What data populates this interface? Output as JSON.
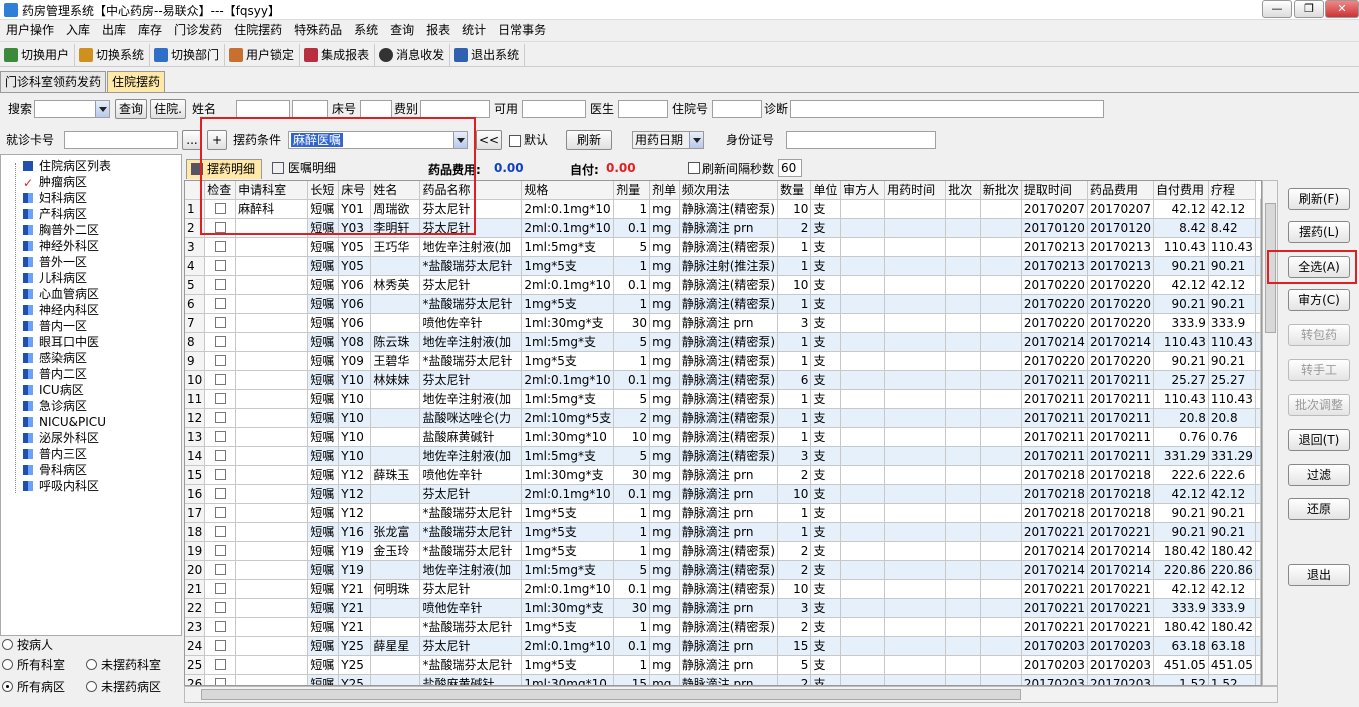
{
  "window": {
    "title": "药房管理系统【中心药房--易联众】---【fqsyy】",
    "controls": [
      "—",
      "❐",
      "✕"
    ]
  },
  "menu": [
    "用户操作",
    "入库",
    "出库",
    "库存",
    "门诊发药",
    "住院摆药",
    "特殊药品",
    "系统",
    "查询",
    "报表",
    "统计",
    "日常事务"
  ],
  "toolbar": [
    "切换用户",
    "切换系统",
    "切换部门",
    "用户锁定",
    "集成报表",
    "消息收发",
    "退出系统"
  ],
  "main_tabs": [
    "门诊科室领药发药",
    "住院摆药"
  ],
  "filters": {
    "search_label": "搜索",
    "query_btn": "查询",
    "ward_btn": "住院.",
    "name_label": "姓名",
    "bed_label": "床号",
    "fee_label": "费别",
    "avail_label": "可用",
    "doctor_label": "医生",
    "inpatient_label": "住院号",
    "diag_label": "诊断",
    "card_label": "就诊卡号",
    "ellipsis_btn": "...",
    "plus_btn": "+",
    "cond_label": "摆药条件",
    "cond_value": "麻醉医嘱",
    "back_btn": "<<",
    "default_label": "默认",
    "refresh_btn": "刷新",
    "date_value": "用药日期",
    "idcard_label": "身份证号"
  },
  "tree": {
    "root": "住院病区列表",
    "items": [
      "肿瘤病区",
      "妇科病区",
      "产科病区",
      "胸普外二区",
      "神经外科区",
      "普外一区",
      "儿科病区",
      "心血管病区",
      "神经内科区",
      "普内一区",
      "眼耳口中医",
      "感染病区",
      "普内二区",
      "ICU病区",
      "急诊病区",
      "NICU&PICU",
      "泌尿外科区",
      "普内三区",
      "骨科病区",
      "呼吸内科区"
    ]
  },
  "radios": {
    "by_patient": "按病人",
    "all_depts": "所有科室",
    "not_dispensed_depts": "未摆药科室",
    "all_wards": "所有病区",
    "not_dispensed_wards": "未摆药病区"
  },
  "subtabs": {
    "tab1": "摆药明细",
    "tab2": "医嘱明细",
    "drug_fee_label": "药品费用:",
    "drug_fee_value": "0.00",
    "self_pay_label": "自付:",
    "self_pay_value": "0.00",
    "refresh_interval_label": "刷新间隔秒数",
    "refresh_interval_value": "60"
  },
  "table": {
    "headers": [
      "",
      "检查",
      "申请科室",
      "长短",
      "床号",
      "姓名",
      "药品名称",
      "规格",
      "剂量",
      "剂单",
      "频次用法",
      "数量",
      "单位",
      "审方人",
      "用药时间",
      "批次",
      "新批次",
      "提取时间",
      "药品费用",
      "自付费用",
      "疗程"
    ],
    "rows": [
      [
        "1",
        "麻醉科",
        "短嘱",
        "Y01",
        "周瑞欲",
        "芬太尼针",
        "2ml:0.1mg*10",
        "1",
        "mg",
        "静脉滴注(精密泵)",
        "10",
        "支",
        "",
        "20170207",
        "20170207",
        "42.12",
        "42.12"
      ],
      [
        "2",
        "",
        "短嘱",
        "Y03",
        "李明轩",
        "芬太尼针",
        "2ml:0.1mg*10",
        "0.1",
        "mg",
        "静脉滴注 prn",
        "2",
        "支",
        "",
        "20170120",
        "20170120",
        "8.42",
        "8.42"
      ],
      [
        "3",
        "",
        "短嘱",
        "Y05",
        "王巧华",
        "地佐辛注射液(加",
        "1ml:5mg*支",
        "5",
        "mg",
        "静脉滴注(精密泵)",
        "1",
        "支",
        "",
        "20170213",
        "20170213",
        "110.43",
        "110.43"
      ],
      [
        "4",
        "",
        "短嘱",
        "Y05",
        "",
        "*盐酸瑞芬太尼针",
        "1mg*5支",
        "1",
        "mg",
        "静脉注射(推注泵)",
        "1",
        "支",
        "",
        "20170213",
        "20170213",
        "90.21",
        "90.21"
      ],
      [
        "5",
        "",
        "短嘱",
        "Y06",
        "林秀英",
        "芬太尼针",
        "2ml:0.1mg*10",
        "0.1",
        "mg",
        "静脉滴注(精密泵)",
        "10",
        "支",
        "",
        "20170220",
        "20170220",
        "42.12",
        "42.12"
      ],
      [
        "6",
        "",
        "短嘱",
        "Y06",
        "",
        "*盐酸瑞芬太尼针",
        "1mg*5支",
        "1",
        "mg",
        "静脉滴注(精密泵)",
        "1",
        "支",
        "",
        "20170220",
        "20170220",
        "90.21",
        "90.21"
      ],
      [
        "7",
        "",
        "短嘱",
        "Y06",
        "",
        "喷他佐辛针",
        "1ml:30mg*支",
        "30",
        "mg",
        "静脉滴注 prn",
        "3",
        "支",
        "",
        "20170220",
        "20170220",
        "333.9",
        "333.9"
      ],
      [
        "8",
        "",
        "短嘱",
        "Y08",
        "陈云珠",
        "地佐辛注射液(加",
        "1ml:5mg*支",
        "5",
        "mg",
        "静脉滴注(精密泵)",
        "1",
        "支",
        "",
        "20170214",
        "20170214",
        "110.43",
        "110.43"
      ],
      [
        "9",
        "",
        "短嘱",
        "Y09",
        "王碧华",
        "*盐酸瑞芬太尼针",
        "1mg*5支",
        "1",
        "mg",
        "静脉滴注(精密泵)",
        "1",
        "支",
        "",
        "20170220",
        "20170220",
        "90.21",
        "90.21"
      ],
      [
        "10",
        "",
        "短嘱",
        "Y10",
        "林妹妹",
        "芬太尼针",
        "2ml:0.1mg*10",
        "0.1",
        "mg",
        "静脉滴注(精密泵)",
        "6",
        "支",
        "",
        "20170211",
        "20170211",
        "25.27",
        "25.27"
      ],
      [
        "11",
        "",
        "短嘱",
        "Y10",
        "",
        "地佐辛注射液(加",
        "1ml:5mg*支",
        "5",
        "mg",
        "静脉滴注(精密泵)",
        "1",
        "支",
        "",
        "20170211",
        "20170211",
        "110.43",
        "110.43"
      ],
      [
        "12",
        "",
        "短嘱",
        "Y10",
        "",
        "盐酸咪达唑仑(力",
        "2ml:10mg*5支",
        "2",
        "mg",
        "静脉滴注(精密泵)",
        "1",
        "支",
        "",
        "20170211",
        "20170211",
        "20.8",
        "20.8"
      ],
      [
        "13",
        "",
        "短嘱",
        "Y10",
        "",
        "盐酸麻黄碱针",
        "1ml:30mg*10",
        "10",
        "mg",
        "静脉滴注(精密泵)",
        "1",
        "支",
        "",
        "20170211",
        "20170211",
        "0.76",
        "0.76"
      ],
      [
        "14",
        "",
        "短嘱",
        "Y10",
        "",
        "地佐辛注射液(加",
        "1ml:5mg*支",
        "5",
        "mg",
        "静脉滴注(精密泵)",
        "3",
        "支",
        "",
        "20170211",
        "20170211",
        "331.29",
        "331.29"
      ],
      [
        "15",
        "",
        "短嘱",
        "Y12",
        "薛珠玉",
        "喷他佐辛针",
        "1ml:30mg*支",
        "30",
        "mg",
        "静脉滴注 prn",
        "2",
        "支",
        "",
        "20170218",
        "20170218",
        "222.6",
        "222.6"
      ],
      [
        "16",
        "",
        "短嘱",
        "Y12",
        "",
        "芬太尼针",
        "2ml:0.1mg*10",
        "0.1",
        "mg",
        "静脉滴注 prn",
        "10",
        "支",
        "",
        "20170218",
        "20170218",
        "42.12",
        "42.12"
      ],
      [
        "17",
        "",
        "短嘱",
        "Y12",
        "",
        "*盐酸瑞芬太尼针",
        "1mg*5支",
        "1",
        "mg",
        "静脉滴注 prn",
        "1",
        "支",
        "",
        "20170218",
        "20170218",
        "90.21",
        "90.21"
      ],
      [
        "18",
        "",
        "短嘱",
        "Y16",
        "张龙富",
        "*盐酸瑞芬太尼针",
        "1mg*5支",
        "1",
        "mg",
        "静脉滴注 prn",
        "1",
        "支",
        "",
        "20170221",
        "20170221",
        "90.21",
        "90.21"
      ],
      [
        "19",
        "",
        "短嘱",
        "Y19",
        "金玉玲",
        "*盐酸瑞芬太尼针",
        "1mg*5支",
        "1",
        "mg",
        "静脉滴注(精密泵)",
        "2",
        "支",
        "",
        "20170214",
        "20170214",
        "180.42",
        "180.42"
      ],
      [
        "20",
        "",
        "短嘱",
        "Y19",
        "",
        "地佐辛注射液(加",
        "1ml:5mg*支",
        "5",
        "mg",
        "静脉滴注(精密泵)",
        "2",
        "支",
        "",
        "20170214",
        "20170214",
        "220.86",
        "220.86"
      ],
      [
        "21",
        "",
        "短嘱",
        "Y21",
        "何明珠",
        "芬太尼针",
        "2ml:0.1mg*10",
        "0.1",
        "mg",
        "静脉滴注(精密泵)",
        "10",
        "支",
        "",
        "20170221",
        "20170221",
        "42.12",
        "42.12"
      ],
      [
        "22",
        "",
        "短嘱",
        "Y21",
        "",
        "喷他佐辛针",
        "1ml:30mg*支",
        "30",
        "mg",
        "静脉滴注 prn",
        "3",
        "支",
        "",
        "20170221",
        "20170221",
        "333.9",
        "333.9"
      ],
      [
        "23",
        "",
        "短嘱",
        "Y21",
        "",
        "*盐酸瑞芬太尼针",
        "1mg*5支",
        "1",
        "mg",
        "静脉滴注(精密泵)",
        "2",
        "支",
        "",
        "20170221",
        "20170221",
        "180.42",
        "180.42"
      ],
      [
        "24",
        "",
        "短嘱",
        "Y25",
        "薛星星",
        "芬太尼针",
        "2ml:0.1mg*10",
        "0.1",
        "mg",
        "静脉滴注 prn",
        "15",
        "支",
        "",
        "20170203",
        "20170203",
        "63.18",
        "63.18"
      ],
      [
        "25",
        "",
        "短嘱",
        "Y25",
        "",
        "*盐酸瑞芬太尼针",
        "1mg*5支",
        "1",
        "mg",
        "静脉滴注 prn",
        "5",
        "支",
        "",
        "20170203",
        "20170203",
        "451.05",
        "451.05"
      ],
      [
        "26",
        "",
        "短嘱",
        "Y25",
        "",
        "盐酸麻黄碱针",
        "1ml:30mg*10",
        "15",
        "mg",
        "静脉滴注 prn",
        "2",
        "支",
        "",
        "20170203",
        "20170203",
        "1.52",
        "1.52"
      ]
    ]
  },
  "side_buttons": [
    "刷新(F)",
    "摆药(L)",
    "全选(A)",
    "审方(C)",
    "转包药",
    "转手工",
    "批次调整",
    "退回(T)",
    "过滤",
    "还原",
    "退出"
  ],
  "colors": {
    "active_tab": "#ffe8a8",
    "highlight": "#e02020",
    "row_alt": "#e6f0fb",
    "cond_select": "#3366cc"
  }
}
